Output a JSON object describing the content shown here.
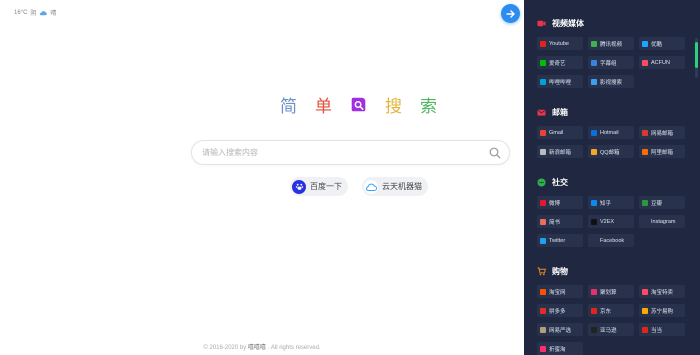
{
  "weather": {
    "temp": "16°C",
    "condition": "阴",
    "extra": "晴"
  },
  "logo": {
    "chars": [
      "简",
      "单",
      "搜",
      "索"
    ],
    "colors": [
      "#6e8fc7",
      "#e0503c",
      "#e4b53a",
      "#4fb55e"
    ],
    "mark_color": "#a12ee0"
  },
  "search": {
    "placeholder": "请输入搜索内容"
  },
  "engines": [
    {
      "label": "百度一下",
      "icon": "baidu-paw-icon",
      "color": "#2932e1"
    },
    {
      "label": "云天机器猫",
      "icon": "cloud-icon",
      "color": "#36a3f7"
    }
  ],
  "footer": {
    "prefix": "© 2016-2020 by ",
    "author": "嘻嘻嘻",
    "suffix": " . All rights reserved."
  },
  "sections": [
    {
      "title": "视频媒体",
      "icon": "video-icon",
      "color": "#e8344b",
      "items": [
        {
          "label": "Youtube",
          "color": "#e62117"
        },
        {
          "label": "腾讯视频",
          "color": "#3fb14a"
        },
        {
          "label": "优酷",
          "color": "#1ba7ff"
        },
        {
          "label": "爱奇艺",
          "color": "#00be06"
        },
        {
          "label": "字幕组",
          "color": "#3b83d8"
        },
        {
          "label": "ACFUN",
          "color": "#fd4c5d"
        },
        {
          "label": "哔哩哔哩",
          "color": "#00a1d6"
        },
        {
          "label": "影视搜索",
          "color": "#3aa0f0"
        }
      ]
    },
    {
      "title": "邮箱",
      "icon": "mail-icon",
      "color": "#e8344b",
      "items": [
        {
          "label": "Gmail",
          "color": "#ea4335"
        },
        {
          "label": "Hotmail",
          "color": "#0a6fd6"
        },
        {
          "label": "网易邮箱",
          "color": "#d43c33"
        },
        {
          "label": "新浪邮箱",
          "color": "#bbbbbb"
        },
        {
          "label": "QQ邮箱",
          "color": "#f5a623"
        },
        {
          "label": "阿里邮箱",
          "color": "#ff6a00"
        }
      ]
    },
    {
      "title": "社交",
      "icon": "chat-icon",
      "color": "#2bb24c",
      "items": [
        {
          "label": "微博",
          "color": "#e6162d"
        },
        {
          "label": "知乎",
          "color": "#0f88eb"
        },
        {
          "label": "豆瓣",
          "color": "#2e963d"
        },
        {
          "label": "简书",
          "color": "#ea6f5a"
        },
        {
          "label": "V2EX",
          "color": "#111111"
        },
        {
          "label": "Instagram",
          "color": "#28324d"
        },
        {
          "label": "Twitter",
          "color": "#1da1f2"
        },
        {
          "label": "Facebook",
          "color": "#28324d"
        }
      ]
    },
    {
      "title": "购物",
      "icon": "cart-icon",
      "color": "#f08a24",
      "items": [
        {
          "label": "淘宝网",
          "color": "#ff5000"
        },
        {
          "label": "聚划算",
          "color": "#e5326b"
        },
        {
          "label": "淘宝特卖",
          "color": "#ff4965"
        },
        {
          "label": "拼多多",
          "color": "#e02e24"
        },
        {
          "label": "京东",
          "color": "#e1251b"
        },
        {
          "label": "苏宁易购",
          "color": "#ffaa00"
        },
        {
          "label": "网易严选",
          "color": "#b4a078"
        },
        {
          "label": "亚马逊",
          "color": "#222222"
        },
        {
          "label": "当当",
          "color": "#e1251b"
        },
        {
          "label": "折蜜淘",
          "color": "#ff2d6b"
        }
      ]
    }
  ]
}
